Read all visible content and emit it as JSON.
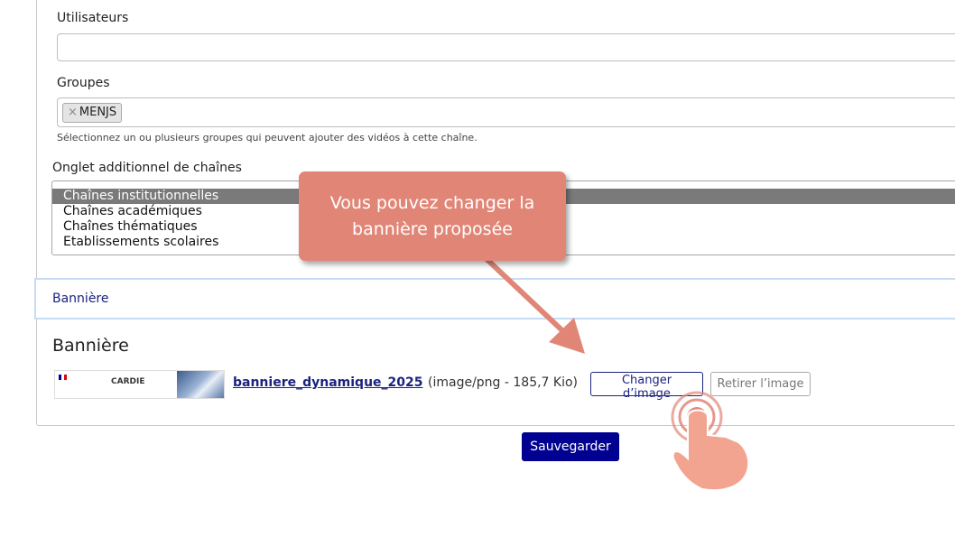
{
  "fields": {
    "users_label": "Utilisateurs",
    "users_value": "",
    "groups_label": "Groupes",
    "group_chip": "MENJS",
    "group_chip_remove": "×",
    "groups_help": "Sélectionnez un ou plusieurs groupes qui peuvent ajouter des vidéos à cette chaîne.",
    "tab_label": "Onglet additionnel de chaînes",
    "tab_options": [
      "Chaînes institutionnelles",
      "Chaînes académiques",
      "Chaînes thématiques",
      "Etablissements scolaires"
    ],
    "tab_selected": "Chaînes institutionnelles"
  },
  "section_bar": {
    "label": "Bannière"
  },
  "banner": {
    "heading": "Bannière",
    "thumbnail_text": "CARDIE",
    "file_name": "banniere_dynamique_2025",
    "file_meta": "(image/png - 185,7 Kio)",
    "change_button": "Changer d’image",
    "remove_button": "Retirer l’image"
  },
  "actions": {
    "save_button": "Sauvegarder"
  },
  "callout": {
    "line1": "Vous pouvez changer la",
    "line2": "bannière proposée"
  },
  "colors": {
    "accent": "#000091",
    "link": "#1a237e",
    "callout": "#e18677",
    "selected_option": "#7a7a7a",
    "section_border": "#c6dcf5"
  },
  "icons": {
    "pointer": "hand-pointer-icon",
    "arrow": "callout-arrow-icon"
  }
}
